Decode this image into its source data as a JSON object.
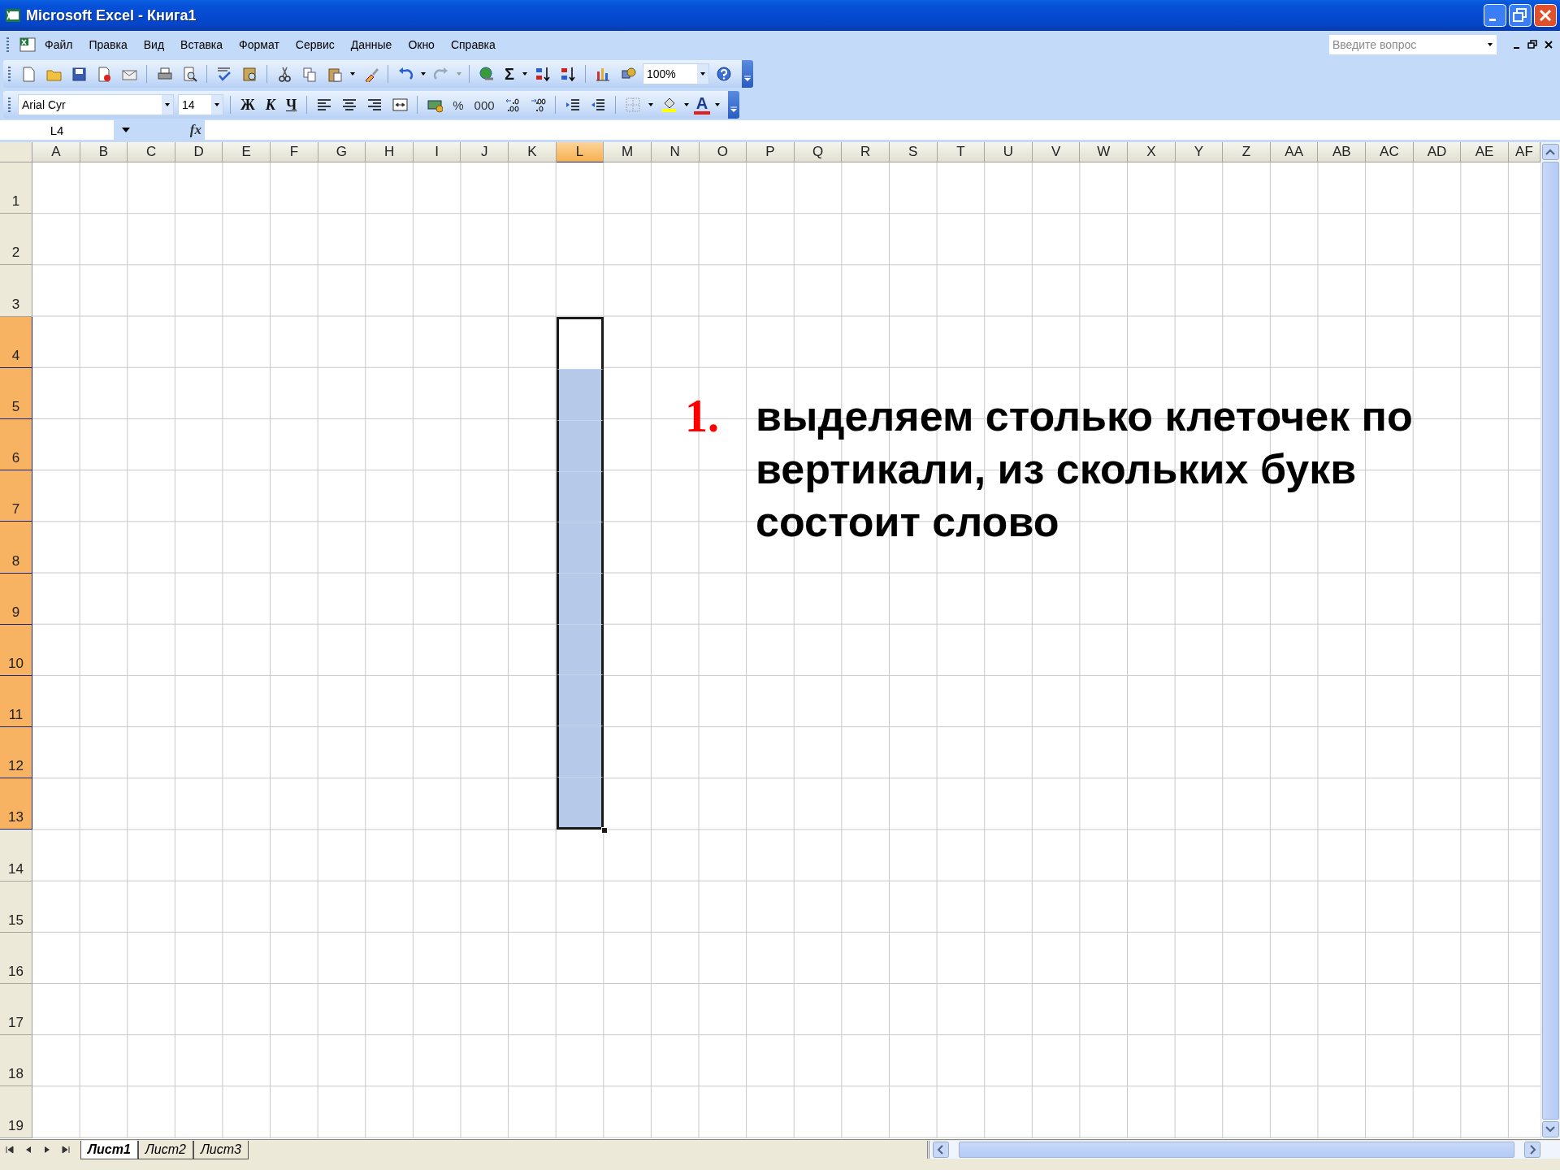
{
  "window": {
    "title": "Microsoft Excel - Книга1"
  },
  "menu": [
    {
      "label": "Файл"
    },
    {
      "label": "Правка"
    },
    {
      "label": "Вид"
    },
    {
      "label": "Вставка"
    },
    {
      "label": "Формат"
    },
    {
      "label": "Сервис"
    },
    {
      "label": "Данные"
    },
    {
      "label": "Окно"
    },
    {
      "label": "Справка"
    }
  ],
  "help_search": {
    "placeholder": "Введите вопрос"
  },
  "standard_toolbar": {
    "sum_symbol": "Σ",
    "zoom": "100%"
  },
  "formatting_toolbar": {
    "font": "Arial Cyr",
    "size": "14",
    "bold": "Ж",
    "italic": "К",
    "underline": "Ч",
    "percent": "%",
    "thousands": "000",
    "font_color_letter": "A"
  },
  "name_box": "L4",
  "function_label": "fx",
  "columns": [
    {
      "label": "A",
      "selected": false
    },
    {
      "label": "B",
      "selected": false
    },
    {
      "label": "C",
      "selected": false
    },
    {
      "label": "D",
      "selected": false
    },
    {
      "label": "E",
      "selected": false
    },
    {
      "label": "F",
      "selected": false
    },
    {
      "label": "G",
      "selected": false
    },
    {
      "label": "H",
      "selected": false
    },
    {
      "label": "I",
      "selected": false
    },
    {
      "label": "J",
      "selected": false
    },
    {
      "label": "K",
      "selected": false
    },
    {
      "label": "L",
      "selected": true
    },
    {
      "label": "M",
      "selected": false
    },
    {
      "label": "N",
      "selected": false
    },
    {
      "label": "O",
      "selected": false
    },
    {
      "label": "P",
      "selected": false
    },
    {
      "label": "Q",
      "selected": false
    },
    {
      "label": "R",
      "selected": false
    },
    {
      "label": "S",
      "selected": false
    },
    {
      "label": "T",
      "selected": false
    },
    {
      "label": "U",
      "selected": false
    },
    {
      "label": "V",
      "selected": false
    },
    {
      "label": "W",
      "selected": false
    },
    {
      "label": "X",
      "selected": false
    },
    {
      "label": "Y",
      "selected": false
    },
    {
      "label": "Z",
      "selected": false
    },
    {
      "label": "AA",
      "selected": false
    },
    {
      "label": "AB",
      "selected": false
    },
    {
      "label": "AC",
      "selected": false
    },
    {
      "label": "AD",
      "selected": false
    },
    {
      "label": "AE",
      "selected": false
    },
    {
      "label": "AF",
      "selected": false
    }
  ],
  "rows": [
    {
      "label": "1",
      "selected": false,
      "active": false
    },
    {
      "label": "2",
      "selected": false,
      "active": false
    },
    {
      "label": "3",
      "selected": false,
      "active": false
    },
    {
      "label": "4",
      "selected": true,
      "active": true
    },
    {
      "label": "5",
      "selected": true,
      "active": false
    },
    {
      "label": "6",
      "selected": true,
      "active": false
    },
    {
      "label": "7",
      "selected": true,
      "active": false
    },
    {
      "label": "8",
      "selected": true,
      "active": false
    },
    {
      "label": "9",
      "selected": true,
      "active": false
    },
    {
      "label": "10",
      "selected": true,
      "active": false
    },
    {
      "label": "11",
      "selected": true,
      "active": false
    },
    {
      "label": "12",
      "selected": true,
      "active": false
    },
    {
      "label": "13",
      "selected": true,
      "active": false
    },
    {
      "label": "14",
      "selected": false,
      "active": false
    },
    {
      "label": "15",
      "selected": false,
      "active": false
    },
    {
      "label": "16",
      "selected": false,
      "active": false
    },
    {
      "label": "17",
      "selected": false,
      "active": false
    },
    {
      "label": "18",
      "selected": false,
      "active": false
    },
    {
      "label": "19",
      "selected": false,
      "active": false
    }
  ],
  "instruction": {
    "number": "1.",
    "text": "выделяем столько клеточек по вертикали, из скольких букв состоит слово"
  },
  "sheet_tabs": [
    {
      "label": "Лист1",
      "selected": true
    },
    {
      "label": "Лист2",
      "selected": false
    },
    {
      "label": "Лист3",
      "selected": false
    }
  ]
}
